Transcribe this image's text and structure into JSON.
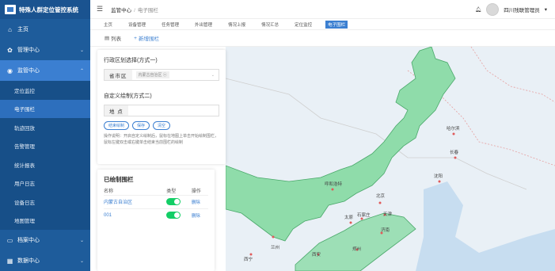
{
  "brand": {
    "title": "特殊人群定位管控系统"
  },
  "sidebar": {
    "items": [
      {
        "label": "主页",
        "icon": "home-icon"
      },
      {
        "label": "管理中心",
        "icon": "gear-icon"
      },
      {
        "label": "监管中心",
        "icon": "location-pin-icon"
      }
    ],
    "sub_items": [
      "定位监控",
      "电子围栏",
      "轨迹回放",
      "告警管理",
      "统计报表",
      "用户日志",
      "设备日志",
      "地图管理"
    ],
    "bottom_items": [
      {
        "label": "档案中心",
        "icon": "folder-icon"
      },
      {
        "label": "数据中心",
        "icon": "grid-icon"
      }
    ]
  },
  "header": {
    "breadcrumb_root": "监管中心",
    "breadcrumb_sep": "/",
    "breadcrumb_current": "电子围栏",
    "user": "四川残联管理员"
  },
  "tabs": [
    "主页",
    "设备管理",
    "任务管理",
    "外出管理",
    "情况上报",
    "情况汇总",
    "定位监控",
    "电子围栏"
  ],
  "subtabs": {
    "list": "列表",
    "add": "新增围栏"
  },
  "panel1": {
    "title1": "行政区划选择(方式一)",
    "region_label": "省市区",
    "region_tag": "内蒙古自治区",
    "title2": "自定义绘制(方式二)",
    "location_label": "地 点",
    "buttons": [
      "结束绘制",
      "保存",
      "清空"
    ],
    "hint": "操作说明：开启自定义绘制后，鼠标在地图上单击开始绘制围栏，鼠标左键双击或右键单击结束当前围栏的绘制"
  },
  "panel2": {
    "title": "已绘制围栏",
    "columns": [
      "名称",
      "类型",
      "操作"
    ],
    "rows": [
      {
        "name": "内蒙古自治区",
        "action": "删除"
      },
      {
        "name": "001",
        "action": "删除"
      }
    ]
  },
  "map": {
    "cities": [
      "哈尔滨",
      "长春",
      "沈阳",
      "呼和浩特",
      "北京",
      "天津",
      "太原",
      "石家庄",
      "济南",
      "兰州",
      "西宁",
      "西安",
      "郑州"
    ],
    "fence_color": "#8fdcaa"
  }
}
